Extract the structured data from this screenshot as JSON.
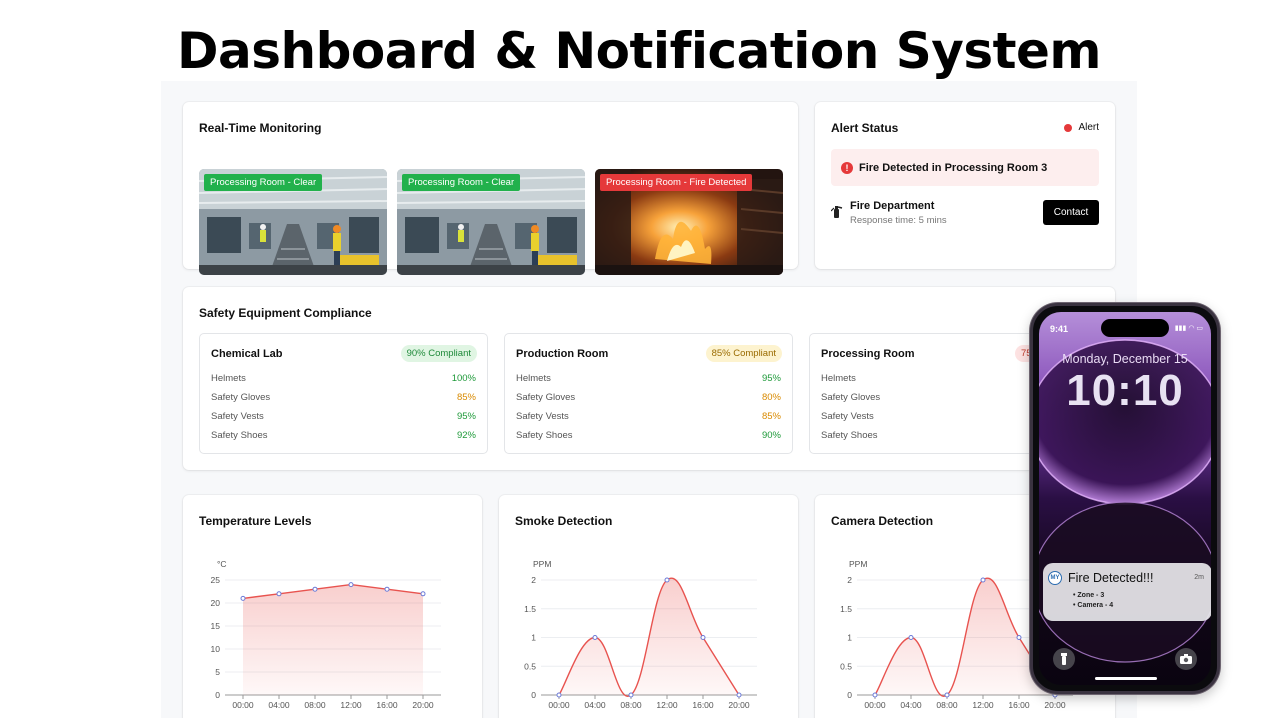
{
  "page_title": "Dashboard & Notification System",
  "monitoring": {
    "title": "Real-Time Monitoring",
    "cameras": [
      {
        "label": "Processing Room - Clear",
        "status": "clear"
      },
      {
        "label": "Processing Room - Clear",
        "status": "clear"
      },
      {
        "label": "Processing Room - Fire Detected",
        "status": "fire"
      }
    ]
  },
  "alert": {
    "title": "Alert Status",
    "indicator": "Alert",
    "message": "Fire Detected in Processing Room 3",
    "contact_name": "Fire Department",
    "response_time": "Response time: 5 mins",
    "contact_button": "Contact"
  },
  "compliance": {
    "title": "Safety Equipment Compliance",
    "rooms": [
      {
        "name": "Chemical Lab",
        "badge": "90% Compliant",
        "level": "green",
        "items": [
          {
            "label": "Helmets",
            "value": "100%",
            "tone": "green"
          },
          {
            "label": "Safety Gloves",
            "value": "85%",
            "tone": "orange"
          },
          {
            "label": "Safety Vests",
            "value": "95%",
            "tone": "green"
          },
          {
            "label": "Safety Shoes",
            "value": "92%",
            "tone": "green"
          }
        ]
      },
      {
        "name": "Production Room",
        "badge": "85% Compliant",
        "level": "yellow",
        "items": [
          {
            "label": "Helmets",
            "value": "95%",
            "tone": "green"
          },
          {
            "label": "Safety Gloves",
            "value": "80%",
            "tone": "orange"
          },
          {
            "label": "Safety Vests",
            "value": "85%",
            "tone": "orange"
          },
          {
            "label": "Safety Shoes",
            "value": "90%",
            "tone": "green"
          }
        ]
      },
      {
        "name": "Processing Room",
        "badge": "75",
        "level": "red",
        "items": [
          {
            "label": "Helmets",
            "value": "",
            "tone": "green"
          },
          {
            "label": "Safety Gloves",
            "value": "",
            "tone": "green"
          },
          {
            "label": "Safety Vests",
            "value": "",
            "tone": "green"
          },
          {
            "label": "Safety Shoes",
            "value": "",
            "tone": "green"
          }
        ]
      }
    ]
  },
  "chart_data": [
    {
      "type": "area",
      "title": "Temperature Levels",
      "ylabel": "°C",
      "x": [
        "00:00",
        "04:00",
        "08:00",
        "12:00",
        "16:00",
        "20:00"
      ],
      "values": [
        21,
        22,
        23,
        24,
        23,
        22
      ],
      "ylim": [
        0,
        25
      ],
      "yticks": [
        "0",
        "5",
        "10",
        "15",
        "20",
        "25"
      ],
      "smooth": false,
      "grid": true,
      "color": "#e8534f"
    },
    {
      "type": "area",
      "title": "Smoke Detection",
      "ylabel": "PPM",
      "x": [
        "00:00",
        "04:00",
        "08:00",
        "12:00",
        "16:00",
        "20:00"
      ],
      "values": [
        0,
        1,
        0,
        2,
        1,
        0
      ],
      "ylim": [
        0,
        2
      ],
      "yticks": [
        "0",
        "0.5",
        "1",
        "1.5",
        "2"
      ],
      "smooth": true,
      "grid": true,
      "color": "#e8534f"
    },
    {
      "type": "area",
      "title": "Camera Detection",
      "ylabel": "PPM",
      "x": [
        "00:00",
        "04:00",
        "08:00",
        "12:00",
        "16:00",
        "20:00"
      ],
      "values": [
        0,
        1,
        0,
        2,
        1,
        0
      ],
      "ylim": [
        0,
        2
      ],
      "yticks": [
        "0",
        "0.5",
        "1",
        "1.5",
        "2"
      ],
      "smooth": true,
      "grid": true,
      "color": "#e8534f"
    }
  ],
  "phone": {
    "status_time": "9:41",
    "date": "Monday, December 15",
    "time": "10:10",
    "notification": {
      "app_icon": "MY",
      "title": "Fire Detected!!!",
      "age": "2m",
      "lines": [
        "• Zone - 3",
        "• Camera - 4"
      ]
    }
  }
}
